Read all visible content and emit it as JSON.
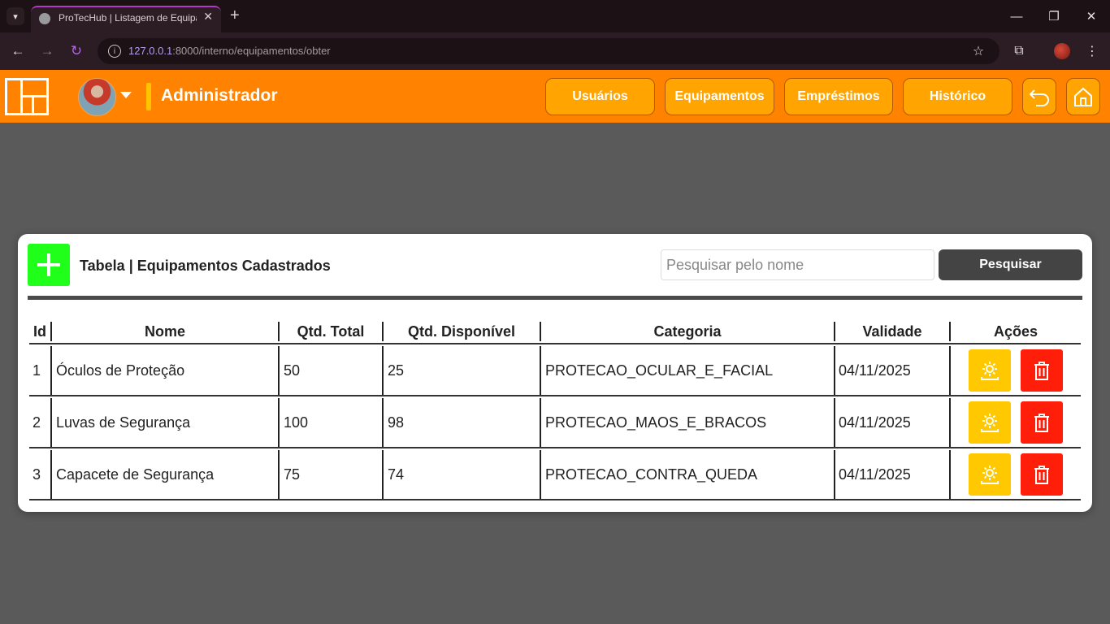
{
  "browser": {
    "tab_title": "ProTecHub | Listagem de Equipamentos",
    "url_host": "127.0.0.1",
    "url_rest": ":8000/interno/equipamentos/obter"
  },
  "header": {
    "role": "Administrador",
    "nav": {
      "usuarios": "Usuários",
      "equipamentos": "Equipamentos",
      "emprestimos": "Empréstimos",
      "historico": "Histórico"
    },
    "accent": "#ff8200"
  },
  "card": {
    "title": "Tabela | Equipamentos Cadastrados",
    "search_placeholder": "Pesquisar pelo nome",
    "search_button": "Pesquisar"
  },
  "table": {
    "columns": {
      "id": "Id",
      "nome": "Nome",
      "total": "Qtd. Total",
      "disponivel": "Qtd. Disponível",
      "categoria": "Categoria",
      "validade": "Validade",
      "acoes": "Ações"
    },
    "rows": [
      {
        "id": "1",
        "nome": "Óculos de Proteção",
        "total": "50",
        "disponivel": "25",
        "categoria": "PROTECAO_OCULAR_E_FACIAL",
        "validade": "04/11/2025"
      },
      {
        "id": "2",
        "nome": "Luvas de Segurança",
        "total": "100",
        "disponivel": "98",
        "categoria": "PROTECAO_MAOS_E_BRACOS",
        "validade": "04/11/2025"
      },
      {
        "id": "3",
        "nome": "Capacete de Segurança",
        "total": "75",
        "disponivel": "74",
        "categoria": "PROTECAO_CONTRA_QUEDA",
        "validade": "04/11/2025"
      }
    ]
  },
  "icons": {
    "edit": "gear-icon",
    "delete": "trash-icon",
    "add": "plus-icon",
    "back": "undo-icon",
    "home": "home-icon"
  }
}
